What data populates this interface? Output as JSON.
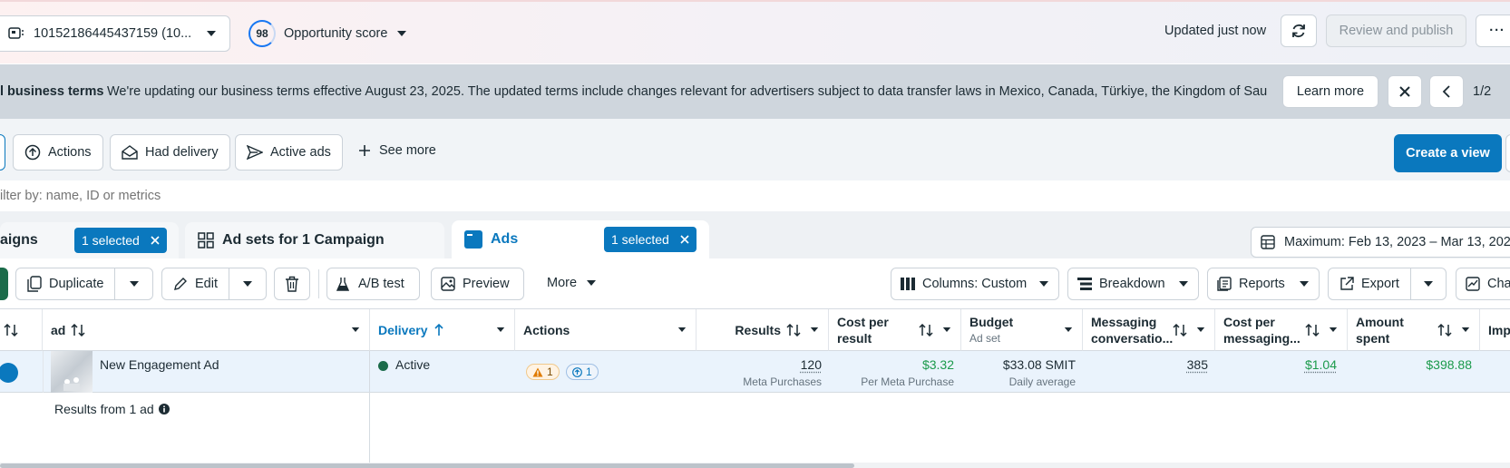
{
  "topbar": {
    "account_id": "10152186445437159 (10...",
    "opportunity_score_value": "98",
    "opportunity_score_label": "Opportunity score",
    "updated_status": "Updated just now",
    "review_publish_label": "Review and publish",
    "more_label": "···"
  },
  "banner": {
    "title": "l business terms",
    "message": "We're updating our business terms effective August 23, 2025. The updated terms include changes relevant for advertisers subject to data transfer laws in Mexico, Canada, Türkiye, the Kingdom of Sau...",
    "learn_more_label": "Learn more",
    "pager": "1/2"
  },
  "filters": {
    "chips": [
      "Actions",
      "Had delivery",
      "Active ads"
    ],
    "see_more_label": "See more",
    "create_view_label": "Create a view"
  },
  "search": {
    "placeholder": "ilter by: name, ID or metrics"
  },
  "tabs": {
    "campaigns_label": "aigns",
    "campaigns_selected": "1 selected",
    "adsets_label": "Ad sets for 1 Campaign",
    "ads_label": "Ads",
    "ads_selected": "1 selected",
    "date_range": "Maximum: Feb 13, 2023 – Mar 13, 2026"
  },
  "toolbar": {
    "duplicate_label": "Duplicate",
    "edit_label": "Edit",
    "ab_test_label": "A/B test",
    "preview_label": "Preview",
    "more_label": "More",
    "columns_label": "Columns: Custom",
    "breakdown_label": "Breakdown",
    "reports_label": "Reports",
    "export_label": "Export",
    "charts_label": "Cha"
  },
  "table": {
    "headers": {
      "ad": "ad",
      "delivery": "Delivery",
      "actions": "Actions",
      "results": "Results",
      "cost_per_result_1": "Cost per",
      "cost_per_result_2": "result",
      "budget": "Budget",
      "budget_sub": "Ad set",
      "messaging_1": "Messaging",
      "messaging_2": "conversatio...",
      "cost_messaging_1": "Cost per",
      "cost_messaging_2": "messaging...",
      "amount_spent_1": "Amount",
      "amount_spent_2": "spent",
      "impressions": "Imp"
    },
    "row": {
      "ad_name": "New Engagement Ad",
      "delivery": "Active",
      "warning_count": "1",
      "boost_count": "1",
      "results": "120",
      "results_sub": "Meta Purchases",
      "cost_per_result": "$3.32",
      "cost_per_result_sub": "Per Meta Purchase",
      "budget": "$33.08 SMIT",
      "budget_sub": "Daily average",
      "messaging": "385",
      "cost_per_messaging": "$1.04",
      "amount_spent": "$398.88"
    },
    "summary": "Results from 1 ad"
  },
  "colors": {
    "primary": "#0a78be",
    "active_green": "#1b6b4a",
    "money_green": "#1b9a4b",
    "warning": "#e07b00"
  }
}
